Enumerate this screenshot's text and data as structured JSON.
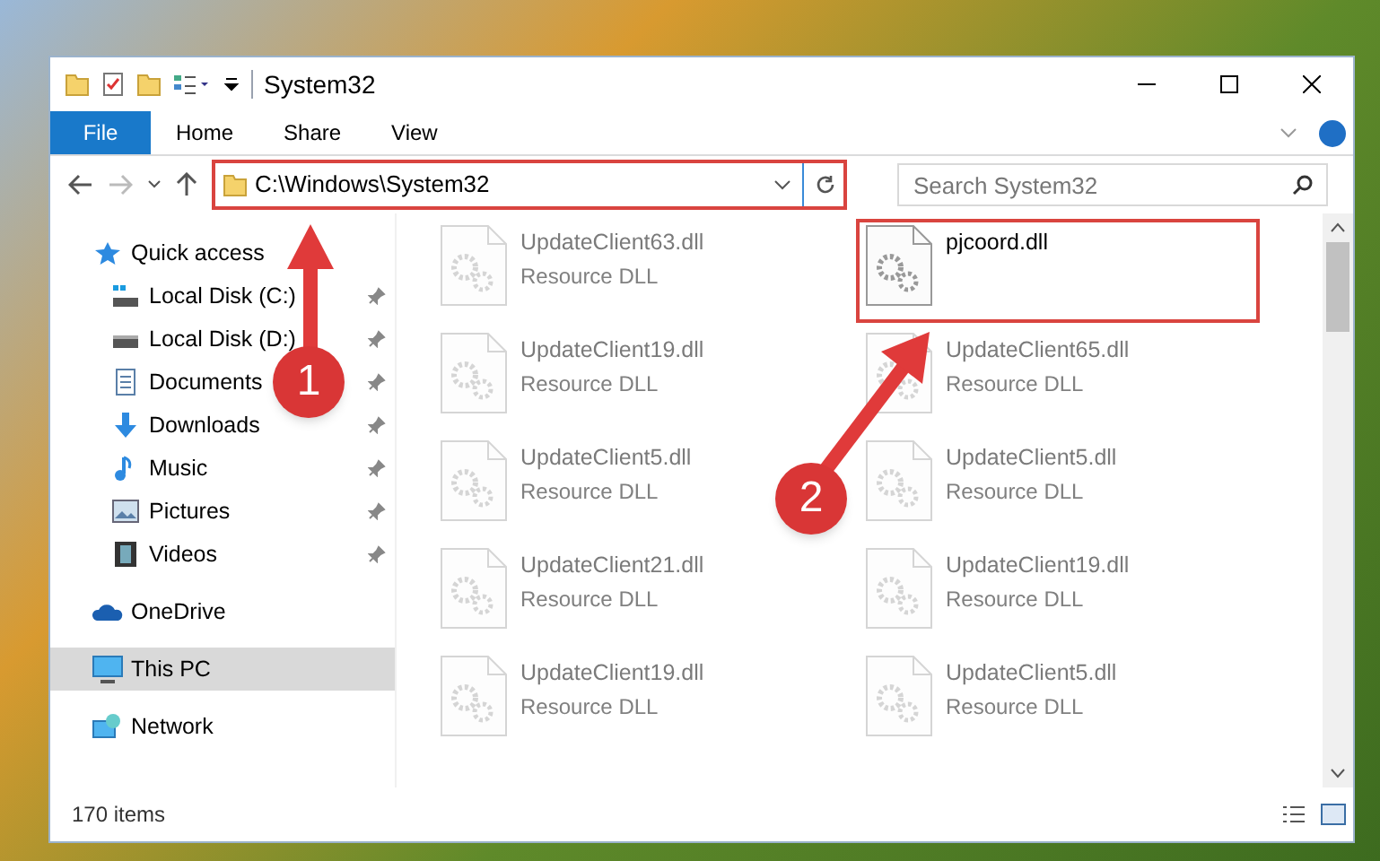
{
  "window": {
    "title": "System32"
  },
  "ribbon": {
    "tabs": [
      {
        "label": "File",
        "kind": "file",
        "selected": false
      },
      {
        "label": "Home",
        "kind": "tab",
        "selected": false
      },
      {
        "label": "Share",
        "kind": "tab",
        "selected": false
      },
      {
        "label": "View",
        "kind": "tab",
        "selected": false
      }
    ]
  },
  "address": {
    "value": "C:\\Windows\\System32",
    "highlighted": true
  },
  "search": {
    "placeholder": "Search System32"
  },
  "sidebar": {
    "items": [
      {
        "label": "Quick access",
        "kind": "star",
        "selected": false,
        "children": [
          {
            "label": "Local Disk (C:)",
            "kind": "drive-c",
            "pinned": true,
            "selected": false
          },
          {
            "label": "Local Disk (D:)",
            "kind": "drive",
            "pinned": true,
            "selected": false
          },
          {
            "label": "Documents",
            "kind": "documents",
            "pinned": true,
            "selected": false
          },
          {
            "label": "Downloads",
            "kind": "downloads",
            "pinned": true,
            "selected": false
          },
          {
            "label": "Music",
            "kind": "music",
            "pinned": true,
            "selected": false
          },
          {
            "label": "Pictures",
            "kind": "pictures",
            "pinned": true,
            "selected": false
          },
          {
            "label": "Videos",
            "kind": "videos",
            "pinned": true,
            "selected": false
          }
        ]
      },
      {
        "label": "OneDrive",
        "kind": "cloud",
        "selected": false
      },
      {
        "label": "This PC",
        "kind": "pc",
        "selected": true
      },
      {
        "label": "Network",
        "kind": "network",
        "selected": false
      }
    ]
  },
  "files": [
    {
      "name": "UpdateClient63.dll",
      "type": "Resource DLL",
      "faded": true,
      "highlighted": false
    },
    {
      "name": "pjcoord.dll",
      "faded": false,
      "highlighted": true
    },
    {
      "name": "UpdateClient19.dll",
      "type": "Resource DLL",
      "faded": true,
      "highlighted": false
    },
    {
      "name": "UpdateClient65.dll",
      "type": "Resource DLL",
      "faded": true,
      "highlighted": false
    },
    {
      "name": "UpdateClient5.dll",
      "type": "Resource DLL",
      "faded": true,
      "highlighted": false
    },
    {
      "name": "UpdateClient5.dll",
      "type": "Resource DLL",
      "faded": true,
      "highlighted": false
    },
    {
      "name": "UpdateClient21.dll",
      "type": "Resource DLL",
      "faded": true,
      "highlighted": false
    },
    {
      "name": "UpdateClient19.dll",
      "type": "Resource DLL",
      "faded": true,
      "highlighted": false
    },
    {
      "name": "UpdateClient19.dll",
      "type": "Resource DLL",
      "faded": true,
      "highlighted": false
    },
    {
      "name": "UpdateClient5.dll",
      "type": "Resource DLL",
      "faded": true,
      "highlighted": false
    }
  ],
  "callouts": [
    {
      "number": "1"
    },
    {
      "number": "2"
    }
  ],
  "status_bar": {
    "count": "170 items"
  }
}
